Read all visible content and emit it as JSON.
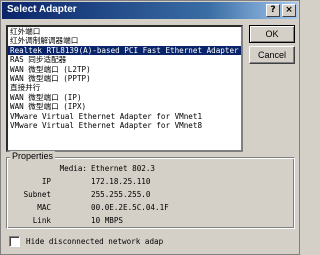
{
  "window": {
    "title": "Select Adapter",
    "help_label": "?",
    "close_label": "×"
  },
  "adapters": [
    "红外端口",
    "红外调制解调器端口",
    "Realtek RTL8139(A)-based PCI Fast Ethernet Adapter",
    "RAS 同步适配器",
    "WAN 微型端口 (L2TP)",
    "WAN 微型端口 (PPTP)",
    "直接并行",
    "WAN 微型端口 (IP)",
    "WAN 微型端口 (IPX)",
    "VMware Virtual Ethernet Adapter for VMnet1",
    "VMware Virtual Ethernet Adapter for VMnet8"
  ],
  "selected_index": 2,
  "buttons": {
    "ok": "OK",
    "cancel": "Cancel"
  },
  "properties": {
    "label": "Properties",
    "media_name": "Media:",
    "media_value": "Ethernet 802.3",
    "ip_name": "IP",
    "ip_value": "172.18.25.110",
    "subnet_name": "Subnet",
    "subnet_value": "255.255.255.0",
    "mac_name": "MAC",
    "mac_value": "00.0E.2E.5C.04.1F",
    "link_name": "Link",
    "link_value": "10 MBPS"
  },
  "hide_disconnected": {
    "label": "Hide disconnected network adap",
    "checked": false
  }
}
